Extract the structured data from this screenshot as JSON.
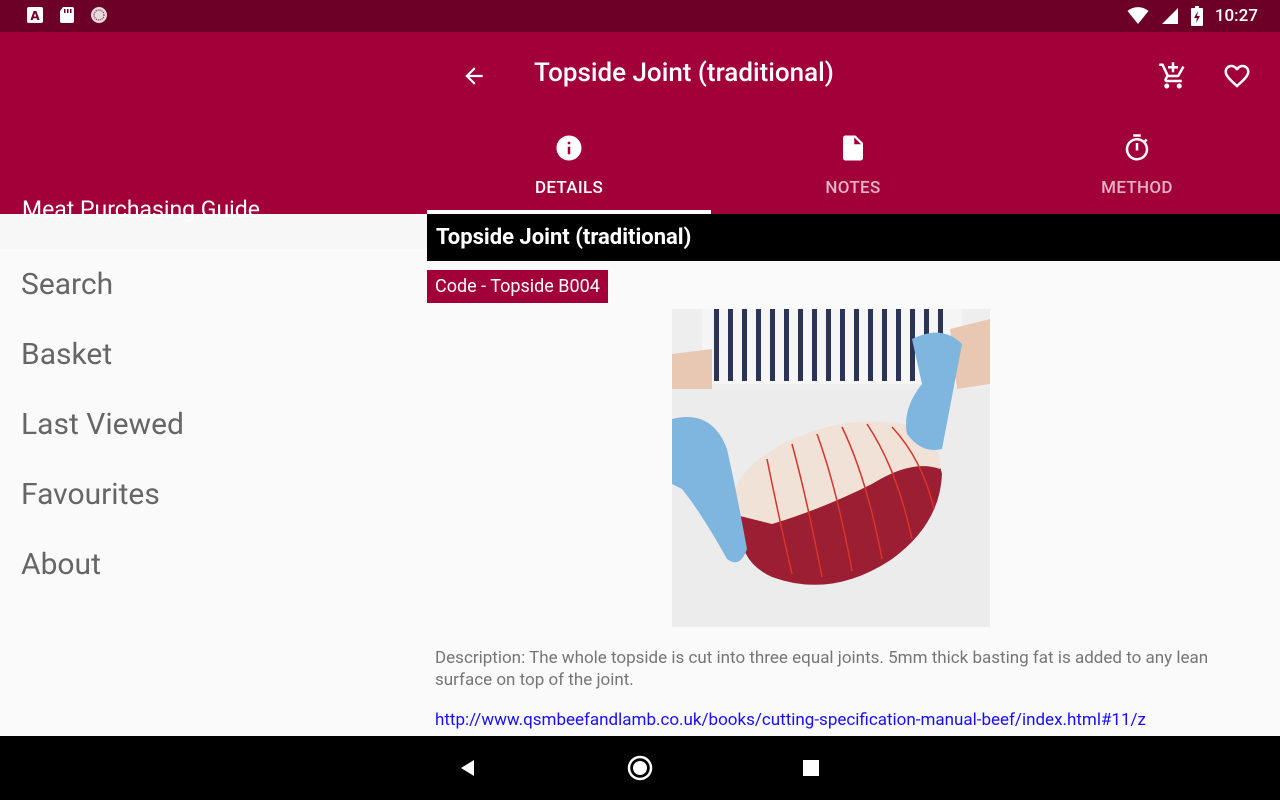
{
  "status_bar": {
    "time": "10:27",
    "icons": [
      "a-icon",
      "sd-card-icon",
      "circle-icon",
      "wifi-icon",
      "signal-icon",
      "battery-charging-icon"
    ]
  },
  "drawer": {
    "title": "Meat Purchasing Guide",
    "items": [
      {
        "label": "Search"
      },
      {
        "label": "Basket"
      },
      {
        "label": "Last Viewed"
      },
      {
        "label": "Favourites"
      },
      {
        "label": "About"
      }
    ]
  },
  "toolbar": {
    "title": "Topside Joint (traditional)",
    "actions": [
      "add-to-cart-icon",
      "heart-icon"
    ]
  },
  "tabs": [
    {
      "label": "DETAILS",
      "icon": "info-icon",
      "active": true
    },
    {
      "label": "NOTES",
      "icon": "file-icon",
      "active": false
    },
    {
      "label": "METHOD",
      "icon": "timer-icon",
      "active": false
    }
  ],
  "product": {
    "name": "Topside Joint (traditional)",
    "code": "Code - Topside B004",
    "description": "Description: The whole topside is cut into three equal joints. 5mm thick basting fat is added to any lean surface on top of the joint.",
    "link": "http://www.qsmbeefandlamb.co.uk/books/cutting-specification-manual-beef/index.html#11/z"
  },
  "colors": {
    "primary": "#a20038",
    "primary_dark": "#6d0026",
    "link": "#1a0dff"
  }
}
